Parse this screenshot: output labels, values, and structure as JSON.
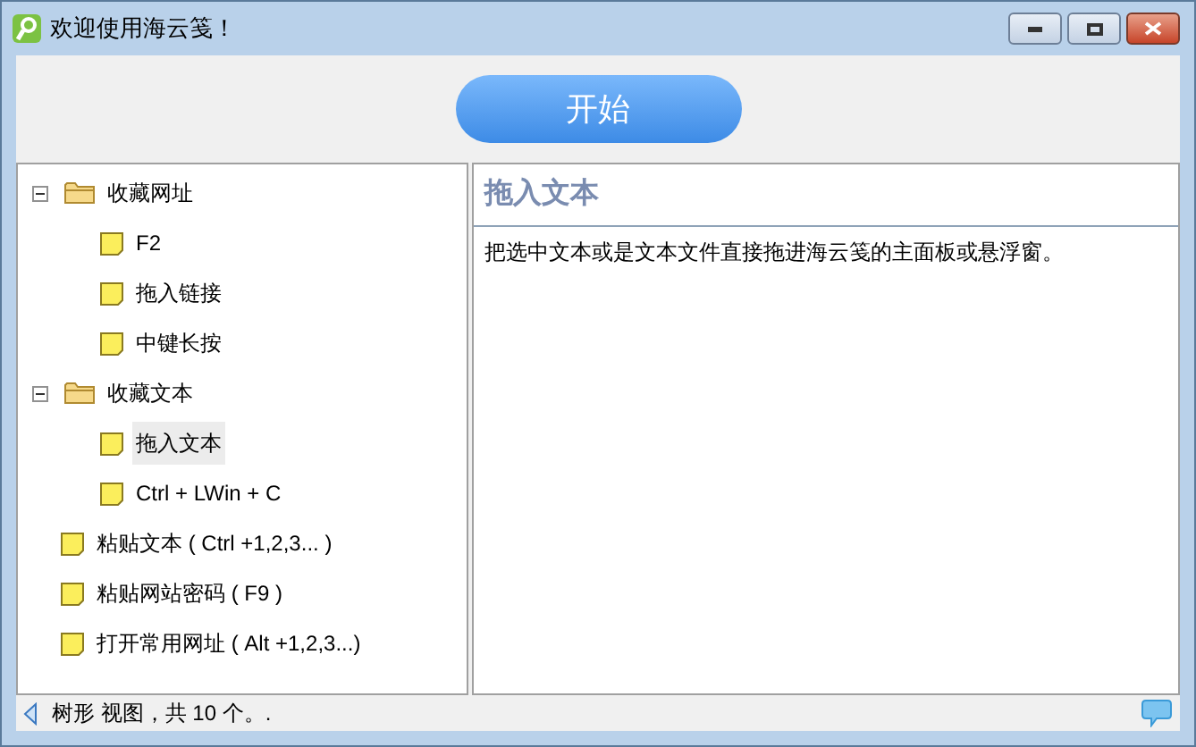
{
  "window": {
    "title": "欢迎使用海云笺！"
  },
  "start_button": "开始",
  "tree": [
    {
      "label": "收藏网址",
      "kind": "folder",
      "expanded": true,
      "selected": false,
      "children": [
        {
          "label": "F2",
          "kind": "note",
          "selected": false
        },
        {
          "label": "拖入链接",
          "kind": "note",
          "selected": false
        },
        {
          "label": "中键长按",
          "kind": "note",
          "selected": false
        }
      ]
    },
    {
      "label": "收藏文本",
      "kind": "folder",
      "expanded": true,
      "selected": false,
      "children": [
        {
          "label": "拖入文本",
          "kind": "note",
          "selected": true
        },
        {
          "label": "Ctrl + LWin + C",
          "kind": "note",
          "selected": false
        }
      ]
    },
    {
      "label": "粘贴文本 ( Ctrl +1,2,3... )",
      "kind": "note",
      "selected": false
    },
    {
      "label": "粘贴网站密码 ( F9 )",
      "kind": "note",
      "selected": false
    },
    {
      "label": "打开常用网址 ( Alt +1,2,3...)",
      "kind": "note",
      "selected": false
    }
  ],
  "detail": {
    "title": "拖入文本",
    "body": "把选中文本或是文本文件直接拖进海云笺的主面板或悬浮窗。"
  },
  "status_bar": "树形 视图，共 10 个。."
}
